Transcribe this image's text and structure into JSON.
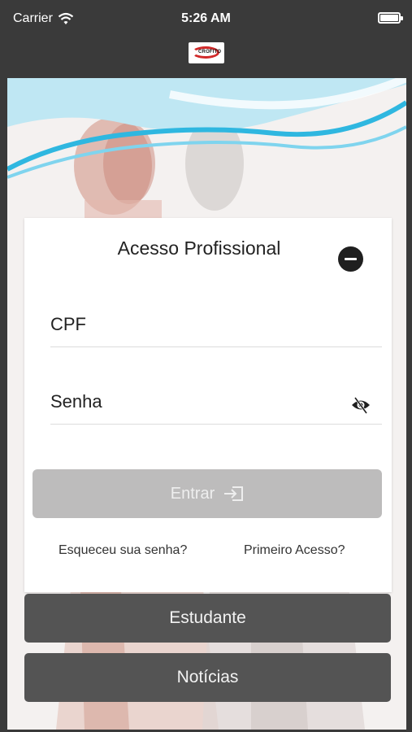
{
  "status_bar": {
    "carrier": "Carrier",
    "time": "5:26 AM"
  },
  "login": {
    "title": "Acesso Profissional",
    "cpf_placeholder": "CPF",
    "password_placeholder": "Senha",
    "enter_label": "Entrar",
    "forgot_password": "Esqueceu sua senha?",
    "first_access": "Primeiro Acesso?"
  },
  "buttons": {
    "student": "Estudante",
    "news": "Notícias"
  },
  "colors": {
    "nav_bar": "#3a3a3a",
    "dark_button": "#545454",
    "disabled_button": "#bdbcbc",
    "wave": "#3fc4e6",
    "logo_red": "#d12a2a"
  },
  "icons": {
    "wifi": "wifi-icon",
    "battery": "battery-icon",
    "logo": "app-logo",
    "collapse": "minus-circle-icon",
    "toggle_password": "eye-slash-icon",
    "enter": "login-arrow-icon"
  }
}
